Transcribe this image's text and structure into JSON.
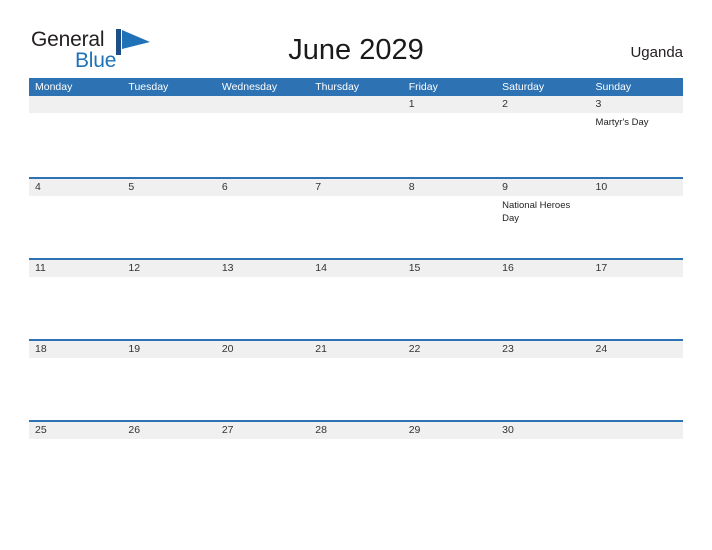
{
  "brand": {
    "name_part1": "General",
    "name_part2": "Blue",
    "flag_color": "#1f72b8",
    "text_color": "#231f20"
  },
  "header": {
    "title": "June 2029",
    "country": "Uganda"
  },
  "theme": {
    "header_blue": "#2d72b3",
    "band_gray": "#f0f0f0",
    "cell_white": "#ffffff",
    "text_dark": "#333333"
  },
  "calendar": {
    "weekdays": [
      "Monday",
      "Tuesday",
      "Wednesday",
      "Thursday",
      "Friday",
      "Saturday",
      "Sunday"
    ],
    "weeks": [
      [
        {
          "date": "",
          "events": []
        },
        {
          "date": "",
          "events": []
        },
        {
          "date": "",
          "events": []
        },
        {
          "date": "",
          "events": []
        },
        {
          "date": "1",
          "events": []
        },
        {
          "date": "2",
          "events": []
        },
        {
          "date": "3",
          "events": [
            "Martyr's Day"
          ]
        }
      ],
      [
        {
          "date": "4",
          "events": []
        },
        {
          "date": "5",
          "events": []
        },
        {
          "date": "6",
          "events": []
        },
        {
          "date": "7",
          "events": []
        },
        {
          "date": "8",
          "events": []
        },
        {
          "date": "9",
          "events": [
            "National Heroes Day"
          ]
        },
        {
          "date": "10",
          "events": []
        }
      ],
      [
        {
          "date": "11",
          "events": []
        },
        {
          "date": "12",
          "events": []
        },
        {
          "date": "13",
          "events": []
        },
        {
          "date": "14",
          "events": []
        },
        {
          "date": "15",
          "events": []
        },
        {
          "date": "16",
          "events": []
        },
        {
          "date": "17",
          "events": []
        }
      ],
      [
        {
          "date": "18",
          "events": []
        },
        {
          "date": "19",
          "events": []
        },
        {
          "date": "20",
          "events": []
        },
        {
          "date": "21",
          "events": []
        },
        {
          "date": "22",
          "events": []
        },
        {
          "date": "23",
          "events": []
        },
        {
          "date": "24",
          "events": []
        }
      ],
      [
        {
          "date": "25",
          "events": []
        },
        {
          "date": "26",
          "events": []
        },
        {
          "date": "27",
          "events": []
        },
        {
          "date": "28",
          "events": []
        },
        {
          "date": "29",
          "events": []
        },
        {
          "date": "30",
          "events": []
        },
        {
          "date": "",
          "events": []
        }
      ]
    ]
  }
}
